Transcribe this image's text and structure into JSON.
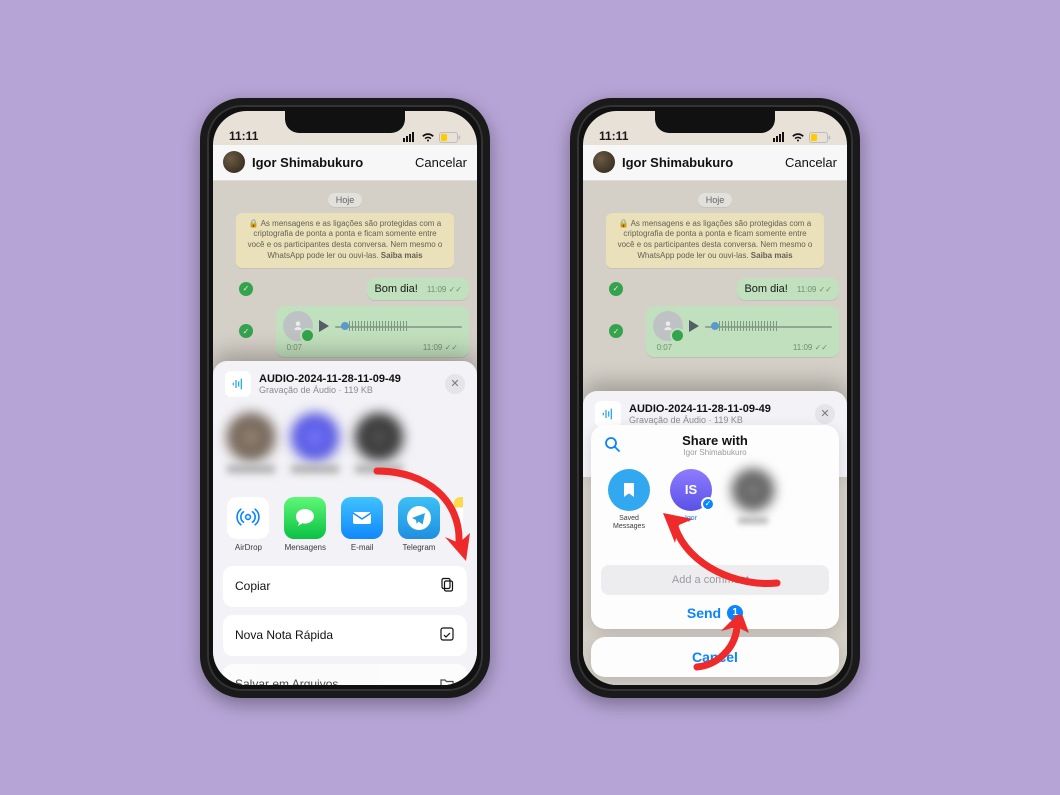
{
  "status": {
    "time": "11:11"
  },
  "chat": {
    "contact_name": "Igor Shimabukuro",
    "cancel": "Cancelar",
    "day": "Hoje",
    "encryption_prefix": "As mensagens e as ligações são protegidas com a criptografia de ponta a ponta e ficam somente entre você e os participantes desta conversa. Nem mesmo o WhatsApp pode ler ou ouvi-las. ",
    "encryption_cta": "Saiba mais",
    "msg1_text": "Bom dia!",
    "msg1_time": "11:09",
    "audio_duration": "0:07",
    "audio_time": "11:09"
  },
  "file": {
    "name": "AUDIO-2024-11-28-11-09-49",
    "subtitle": "Gravação de Áudio · 119 KB"
  },
  "apps": {
    "airdrop": "AirDrop",
    "messages": "Mensagens",
    "mail": "E-mail",
    "telegram": "Telegram"
  },
  "actions": {
    "copy": "Copiar",
    "quicknote": "Nova Nota Rápida",
    "save_files": "Salvar em Arquivos"
  },
  "telegram": {
    "title": "Share with",
    "subtitle": "Igor Shimabukuro",
    "saved": "Saved\nMessages",
    "contact_initials": "IS",
    "contact_name": "Igor",
    "comment_placeholder": "Add a comment...",
    "send": "Send",
    "send_count": "1",
    "cancel": "Cancel"
  }
}
